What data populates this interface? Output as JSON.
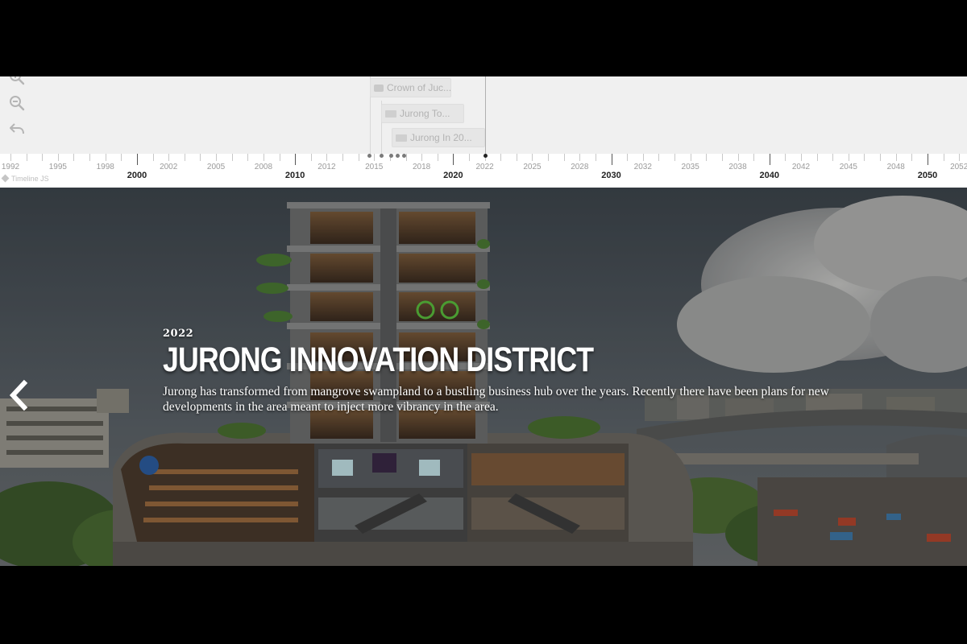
{
  "nav": {
    "markers": [
      {
        "label": "Crown of Juc...",
        "type": "video"
      },
      {
        "label": "Jurong To...",
        "type": "image"
      },
      {
        "label": "Jurong In 20...",
        "type": "image"
      }
    ],
    "axis": {
      "minor_years": [
        "1992",
        "1995",
        "1998",
        "2002",
        "2005",
        "2008",
        "2012",
        "2015",
        "2018",
        "2022",
        "2025",
        "2028",
        "2032",
        "2035",
        "2038",
        "2042",
        "2045",
        "2048",
        "2052"
      ],
      "major_years": [
        "2000",
        "2010",
        "2020",
        "2030",
        "2040",
        "2050"
      ]
    },
    "brand_label": "Timeline JS"
  },
  "slide": {
    "year": "2022",
    "headline": "JURONG INNOVATION DISTRICT",
    "description": "Jurong has transformed from mangrove swampland to a bustling business hub over the years. Recently there have been plans for new developments in the area meant to inject more vibrancy in the area."
  },
  "icons": {
    "zoom_in": "zoom-in-icon",
    "zoom_out": "zoom-out-icon",
    "back": "back-icon",
    "prev": "chevron-left-icon"
  },
  "colors": {
    "nav_background": "#f0f0f0",
    "axis_background": "#ffffff",
    "headline_text": "#ffffff",
    "frame_background": "#000000"
  }
}
